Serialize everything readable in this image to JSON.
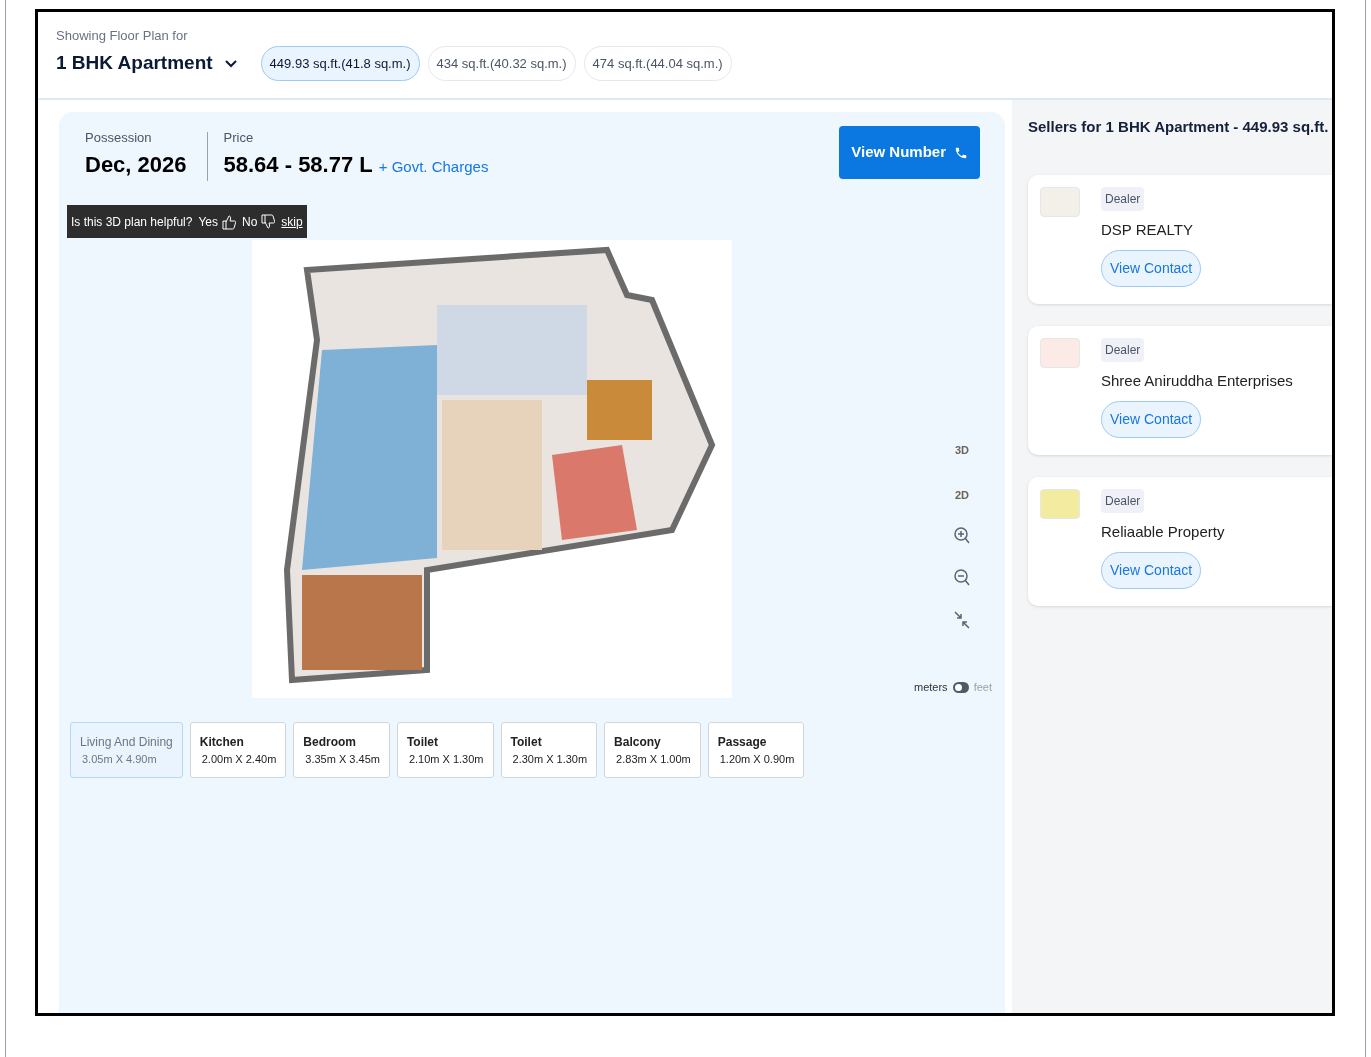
{
  "header": {
    "caption": "Showing Floor Plan for",
    "config": "1 BHK Apartment",
    "sizes": [
      {
        "label": "449.93 sq.ft.(41.8 sq.m.)",
        "selected": true
      },
      {
        "label": "434 sq.ft.(40.32 sq.m.)",
        "selected": false
      },
      {
        "label": "474 sq.ft.(44.04 sq.m.)",
        "selected": false
      }
    ]
  },
  "summary": {
    "possession_label": "Possession",
    "possession": "Dec, 2026",
    "price_label": "Price",
    "price": "58.64 - 58.77 L",
    "price_extra": "+ Govt. Charges",
    "cta": "View Number"
  },
  "feedback": {
    "question": "Is this 3D plan helpful?",
    "yes": "Yes",
    "no": "No",
    "skip": "skip"
  },
  "view_modes": [
    "3D",
    "2D"
  ],
  "units": [
    {
      "label": "meters",
      "selected": true
    },
    {
      "label": "feet",
      "selected": false
    }
  ],
  "rooms": [
    {
      "name": "Living And Dining",
      "size": "3.05m X 4.90m",
      "selected": true
    },
    {
      "name": "Kitchen",
      "size": "2.00m X 2.40m",
      "selected": false
    },
    {
      "name": "Bedroom",
      "size": "3.35m X 3.45m",
      "selected": false
    },
    {
      "name": "Toilet",
      "size": "2.10m X 1.30m",
      "selected": false
    },
    {
      "name": "Toilet",
      "size": "2.30m X 1.30m",
      "selected": false
    },
    {
      "name": "Balcony",
      "size": "2.83m X 1.00m",
      "selected": false
    },
    {
      "name": "Passage",
      "size": "1.20m X 0.90m",
      "selected": false
    }
  ],
  "sellers": {
    "title": "Sellers for 1 BHK Apartment - 449.93 sq.ft.",
    "items": [
      {
        "badge": "Dealer",
        "name": "DSP REALTY",
        "action": "View Contact"
      },
      {
        "badge": "Dealer",
        "name": "Shree Aniruddha Enterprises",
        "action": "View Contact"
      },
      {
        "badge": "Dealer",
        "name": "Reliaable Property",
        "action": "View Contact"
      }
    ]
  }
}
